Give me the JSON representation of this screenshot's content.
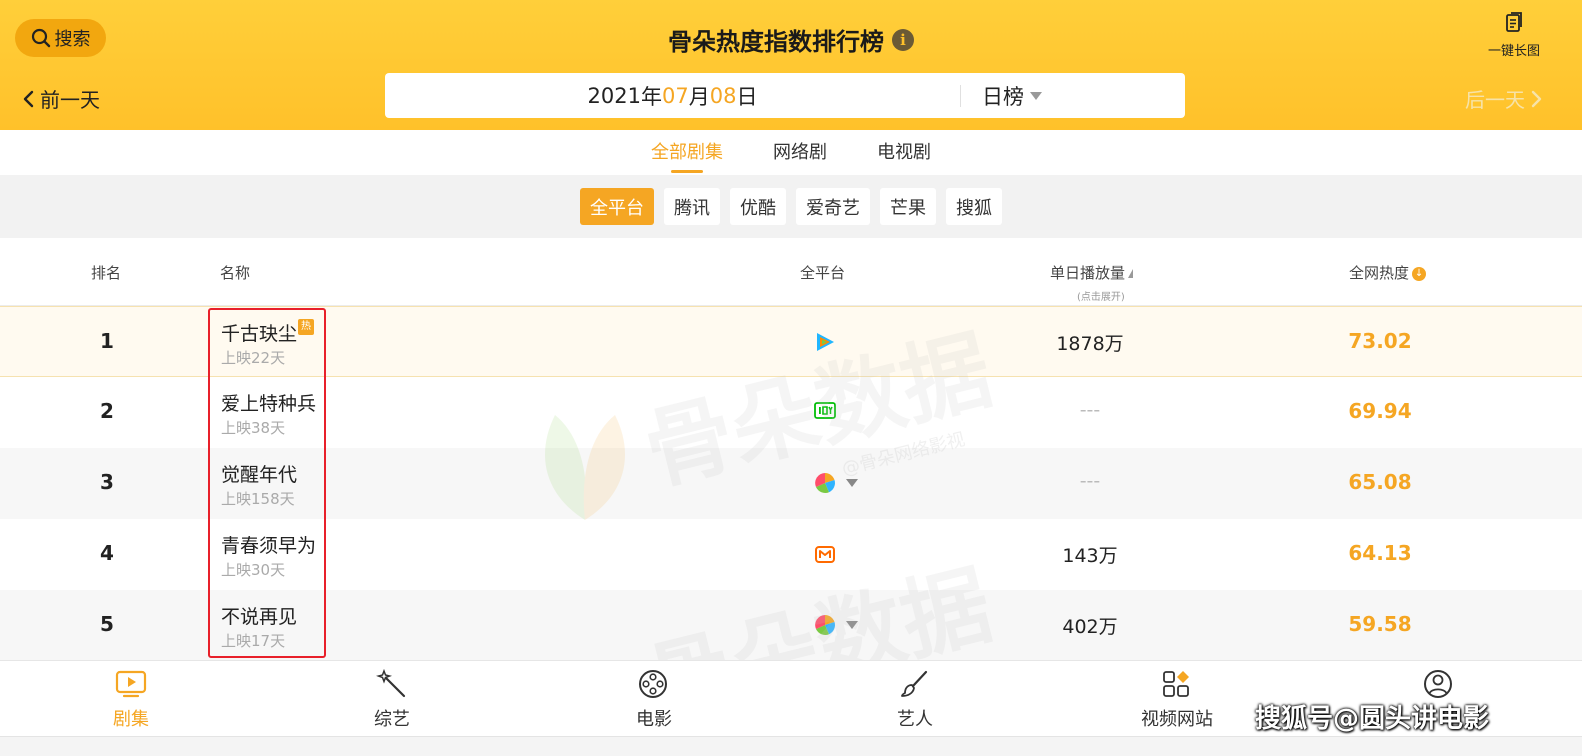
{
  "header": {
    "search_label": "搜索",
    "title": "骨朵热度指数排行榜",
    "info_glyph": "i",
    "long_image_label": "一键长图",
    "prev_day_label": "前一天",
    "next_day_label": "后一天",
    "date": {
      "year": "2021",
      "year_unit": "年",
      "month": "07",
      "month_unit": "月",
      "day": "08",
      "day_unit": "日"
    },
    "rank_type": "日榜"
  },
  "tabs": [
    {
      "label": "全部剧集",
      "active": true
    },
    {
      "label": "网络剧",
      "active": false
    },
    {
      "label": "电视剧",
      "active": false
    }
  ],
  "platforms": [
    {
      "label": "全平台",
      "active": true
    },
    {
      "label": "腾讯",
      "active": false
    },
    {
      "label": "优酷",
      "active": false
    },
    {
      "label": "爱奇艺",
      "active": false
    },
    {
      "label": "芒果",
      "active": false
    },
    {
      "label": "搜狐",
      "active": false
    }
  ],
  "table": {
    "headers": {
      "rank": "排名",
      "name": "名称",
      "platform": "全平台",
      "daily_plays": "单日播放量",
      "daily_plays_hint": "(点击展开)",
      "heat": "全网热度",
      "heat_icon_glyph": "↓"
    },
    "hot_tag": "热",
    "rows": [
      {
        "rank": "1",
        "name": "千古玦尘",
        "days": "上映22天",
        "hot": true,
        "platform_icon": "tencent-video-icon",
        "daily_plays": "1878万",
        "heat": "73.02"
      },
      {
        "rank": "2",
        "name": "爱上特种兵",
        "days": "上映38天",
        "hot": false,
        "platform_icon": "iqiyi-icon",
        "daily_plays": "---",
        "heat": "69.94"
      },
      {
        "rank": "3",
        "name": "觉醒年代",
        "days": "上映158天",
        "hot": false,
        "platform_icon": "multi-platform-icon",
        "daily_plays": "---",
        "heat": "65.08"
      },
      {
        "rank": "4",
        "name": "青春须早为",
        "days": "上映30天",
        "hot": false,
        "platform_icon": "mango-tv-icon",
        "daily_plays": "143万",
        "heat": "64.13"
      },
      {
        "rank": "5",
        "name": "不说再见",
        "days": "上映17天",
        "hot": false,
        "platform_icon": "multi-platform-icon",
        "daily_plays": "402万",
        "heat": "59.58"
      }
    ]
  },
  "watermark": {
    "main": "骨朵数据",
    "sub": "@骨朵网络影视"
  },
  "bottom_nav": [
    {
      "label": "剧集",
      "icon": "tv-play-icon",
      "active": true
    },
    {
      "label": "综艺",
      "icon": "magic-wand-icon",
      "active": false
    },
    {
      "label": "电影",
      "icon": "film-reel-icon",
      "active": false
    },
    {
      "label": "艺人",
      "icon": "brush-icon",
      "active": false
    },
    {
      "label": "视频网站",
      "icon": "apps-grid-icon",
      "active": false
    },
    {
      "label": "",
      "icon": "user-avatar-icon",
      "active": false
    }
  ],
  "credit": "搜狐号@圆头讲电影",
  "colors": {
    "header_bg": "#ffc12a",
    "accent": "#f5a623",
    "highlight_box": "#e8202a",
    "row_highlight": "#fffaf0"
  }
}
